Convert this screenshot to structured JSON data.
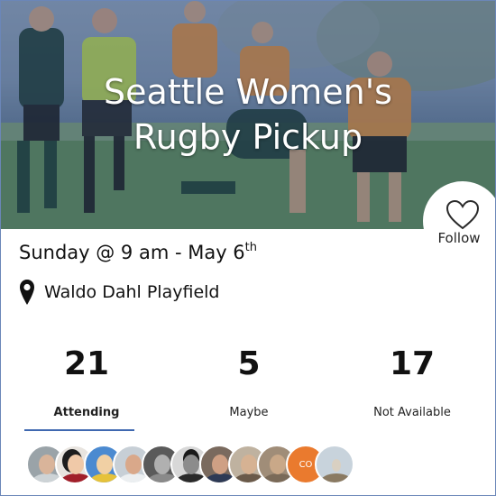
{
  "event": {
    "title_line1": "Seattle Women's",
    "title_line2": "Rugby Pickup",
    "date_text": "Sunday @ 9 am - May 6",
    "date_suffix": "th",
    "location": "Waldo Dahl Playfield"
  },
  "follow": {
    "label": "Follow",
    "icon": "heart-outline-icon"
  },
  "rsvp": {
    "attending": {
      "count": "21",
      "label": "Attending"
    },
    "maybe": {
      "count": "5",
      "label": "Maybe"
    },
    "not_available": {
      "count": "17",
      "label": "Not Available"
    },
    "active_tab": "attending"
  },
  "avatars": [
    {
      "name": "attendee-1",
      "initials": ""
    },
    {
      "name": "attendee-2",
      "initials": ""
    },
    {
      "name": "attendee-3",
      "initials": ""
    },
    {
      "name": "attendee-4",
      "initials": ""
    },
    {
      "name": "attendee-5",
      "initials": ""
    },
    {
      "name": "attendee-6",
      "initials": ""
    },
    {
      "name": "attendee-7",
      "initials": ""
    },
    {
      "name": "attendee-8",
      "initials": ""
    },
    {
      "name": "attendee-9",
      "initials": ""
    },
    {
      "name": "attendee-10",
      "initials": "CO"
    },
    {
      "name": "attendee-11",
      "initials": ""
    }
  ],
  "colors": {
    "accent": "#3f68b0",
    "overlay": "#284678",
    "border": "#6b86b8"
  }
}
